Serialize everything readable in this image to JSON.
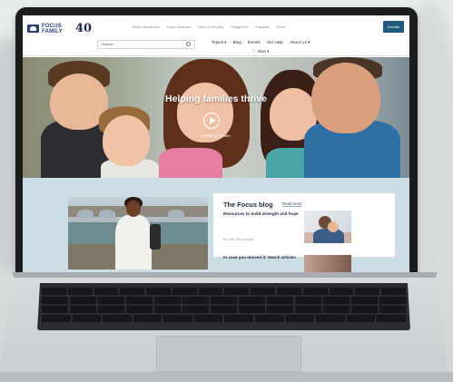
{
  "site": {
    "logo_text": "FOCUS FAMILY",
    "anniversary_mark": "40"
  },
  "utility_nav": [
    "Radio Broadcast",
    "Hope Restored",
    "Kids of Integrity",
    "Plugged In",
    "Français",
    "Store"
  ],
  "donate_label": "Donate",
  "search": {
    "placeholder": "Search"
  },
  "main_nav": [
    "Topics ▾",
    "Blog",
    "Events",
    "Get Help",
    "About Us ▾"
  ],
  "give_label": "Give ▾",
  "hero": {
    "title": "Helping families thrive",
    "cta": "Watch our video"
  },
  "blog": {
    "heading": "The Focus blog",
    "read_more": "Read more",
    "featured_title": "Resources to build strength and hope",
    "featured_byline": "BY ADE OBILUENAS",
    "secondary_title": "In case you missed it: March articles"
  }
}
